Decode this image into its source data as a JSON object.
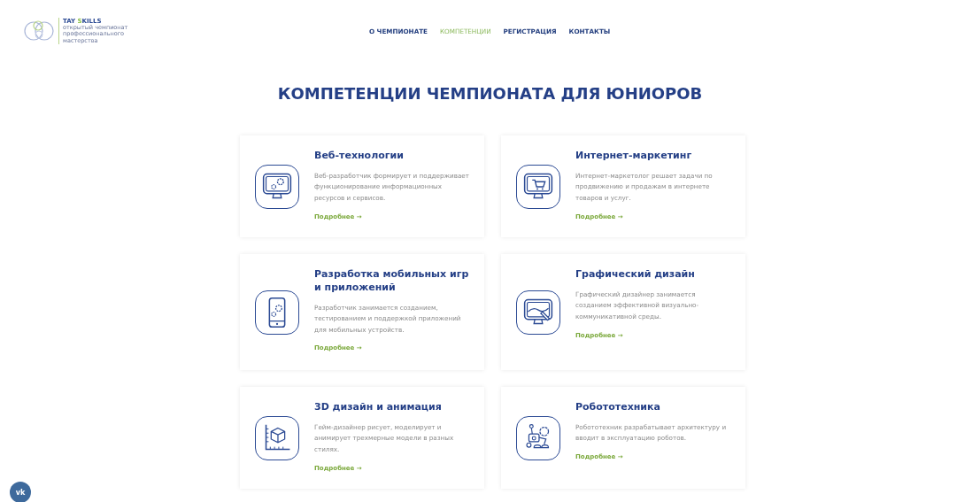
{
  "header": {
    "brand": [
      {
        "text": "TAY ",
        "accent": false
      },
      {
        "text": "S",
        "accent": true
      },
      {
        "text": "KILLS",
        "accent": false
      }
    ],
    "tagline": "открытый чемпионат профессионального мастерства",
    "nav": [
      {
        "label": "О ЧЕМПИОНАТЕ",
        "selected": false
      },
      {
        "label": "КОМПЕТЕНЦИИ",
        "selected": true
      },
      {
        "label": "РЕГИСТРАЦИЯ",
        "selected": false
      },
      {
        "label": "КОНТАКТЫ",
        "selected": false
      }
    ]
  },
  "heading": "КОМПЕТЕНЦИИ ЧЕМПИОНАТА ДЛЯ ЮНИОРОВ",
  "cards": [
    {
      "kind": "web",
      "title": "Веб-технологии",
      "text": "Веб-разработчик формирует и поддерживает функционирование информационных ресурсов и сервисов.",
      "link": "Подробнее →"
    },
    {
      "kind": "marketing",
      "title": "Интернет-маркетинг",
      "text": "Интернет-маркетолог решает задачи по продвижению и продажам в интернете товаров и услуг.",
      "link": "Подробнее →"
    },
    {
      "kind": "mobile",
      "title": "Разработка мобильных игр и приложений",
      "text": "Разработчик занимается созданием, тестированием и поддержкой приложений для мобильных устройств.",
      "link": "Подробнее →"
    },
    {
      "kind": "graphic",
      "title": "Графический дизайн",
      "text": "Графический дизайнер занимается созданием эффективной визуально-коммуникативной среды.",
      "link": "Подробнее →"
    },
    {
      "kind": "modeling",
      "title": "3D дизайн и анимация",
      "text": "Гейм-дизайнер рисует, моделирует и анимирует трехмерные модели в разных стилях.",
      "link": "Подробнее →"
    },
    {
      "kind": "robot",
      "title": "Робототехника",
      "text": "Робототехник разрабатывает архитектуру и вводит в эксплуатацию роботов.",
      "link": "Подробнее →"
    }
  ],
  "social": {
    "label": "vk"
  }
}
